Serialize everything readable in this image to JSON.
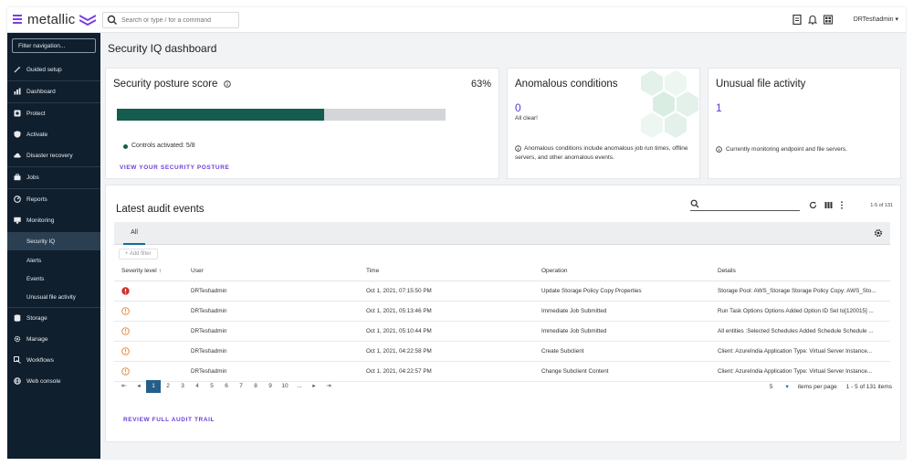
{
  "app": {
    "brand": "metallic",
    "brand_color": "#7b3fe4",
    "search": {
      "placeholder": "Search or type / for a command"
    },
    "user": "DRTest\\admin"
  },
  "sidebar": {
    "filter_label": "Filter navigation...",
    "items": [
      {
        "label": "Guided setup",
        "icon": "wand-icon"
      },
      {
        "label": "Dashboard",
        "icon": "chart-icon"
      },
      {
        "label": "Protect",
        "icon": "shield-box-icon"
      },
      {
        "label": "Activate",
        "icon": "shield-icon"
      },
      {
        "label": "Disaster recovery",
        "icon": "cloud-icon"
      },
      {
        "label": "Jobs",
        "icon": "briefcase-icon"
      },
      {
        "label": "Reports",
        "icon": "gauge-icon"
      },
      {
        "label": "Monitoring",
        "icon": "monitor-icon"
      }
    ],
    "sub_items": [
      "Security IQ",
      "Alerts",
      "Events",
      "Unusual file activity"
    ],
    "lower_items": [
      {
        "label": "Storage",
        "icon": "database-icon"
      },
      {
        "label": "Manage",
        "icon": "gear-icon"
      },
      {
        "label": "Workflows",
        "icon": "workflow-icon"
      },
      {
        "label": "Web console",
        "icon": "globe-icon"
      }
    ]
  },
  "page": {
    "title": "Security IQ dashboard"
  },
  "posture": {
    "title": "Security posture score",
    "percent_label": "63%",
    "percent": 0.63,
    "controls": "Controls activated: 5/8",
    "link": "VIEW YOUR SECURITY POSTURE",
    "bar_color": "#145c4e"
  },
  "anomalous": {
    "title": "Anomalous conditions",
    "count": "0",
    "status": "All clear!",
    "note": "Anomalous conditions include anomalous job run times, offline servers, and other anomalous events."
  },
  "unusual": {
    "title": "Unusual file activity",
    "count": "1",
    "note": "Currently monitoring endpoint and file servers."
  },
  "audit": {
    "title": "Latest audit events",
    "count_label": "1-5 of 131",
    "tab": "All",
    "add_filter": "+ Add filter",
    "columns": [
      "Severity level ↑",
      "User",
      "Time",
      "Operation",
      "Details"
    ],
    "rows": [
      {
        "severity": "critical",
        "user": "DRTest\\admin",
        "time": "Oct 1, 2021, 07:15:50 PM",
        "operation": "Update Storage Policy Copy Properties",
        "details": "Storage Pool: AWS_Storage Storage Policy Copy: AWS_Sto..."
      },
      {
        "severity": "warning",
        "user": "DRTest\\admin",
        "time": "Oct 1, 2021, 05:13:46 PM",
        "operation": "Immediate Job Submitted",
        "details": "Run Task Options Options Added Option ID Set to[120015] ..."
      },
      {
        "severity": "warning",
        "user": "DRTest\\admin",
        "time": "Oct 1, 2021, 05:10:44 PM",
        "operation": "Immediate Job Submitted",
        "details": "All entities :Selected Schedules Added Schedule Schedule ..."
      },
      {
        "severity": "warning",
        "user": "DRTest\\admin",
        "time": "Oct 1, 2021, 04:22:58 PM",
        "operation": "Create Subclient",
        "details": "Client: AzureIndia Application Type: Virtual Server Instance..."
      },
      {
        "severity": "warning",
        "user": "DRTest\\admin",
        "time": "Oct 1, 2021, 04:22:57 PM",
        "operation": "Change Subclient Content",
        "details": "Client: AzureIndia Application Type: Virtual Server Instance..."
      }
    ],
    "pages": [
      "1",
      "2",
      "3",
      "4",
      "5",
      "6",
      "7",
      "8",
      "9",
      "10",
      "..."
    ],
    "per_page_value": "5",
    "per_page_label": "items per page",
    "range_label": "1 - 5 of 131 items",
    "review_link": "REVIEW FULL AUDIT TRAIL",
    "critical_color": "#d0342c",
    "warning_color": "#e8893a"
  }
}
